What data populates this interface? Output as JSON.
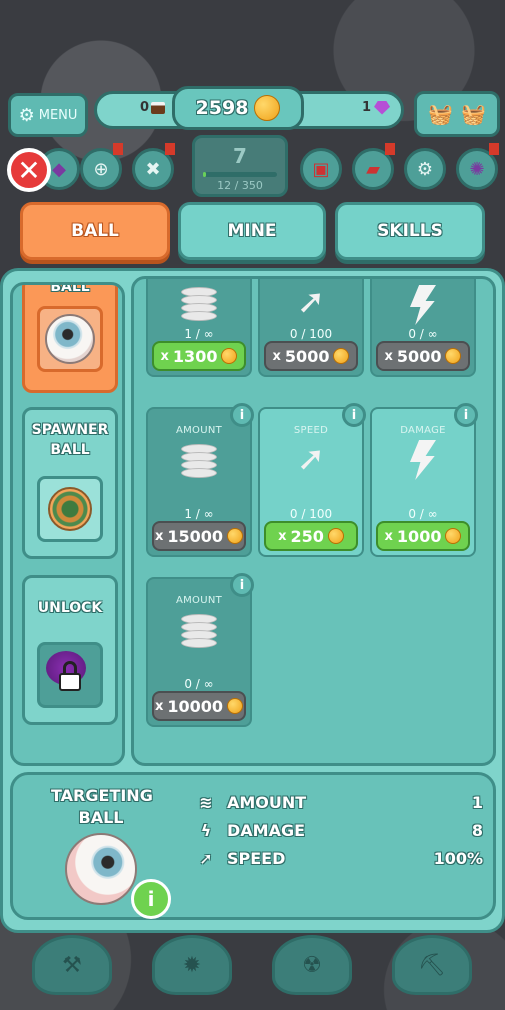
{
  "top_bar": {
    "menu_label": "MENU",
    "left_resource": "0",
    "gold_amount": "2598",
    "gem_amount": "1"
  },
  "level": {
    "number": "7",
    "progress_text": "12 / 350",
    "progress_fraction": 0.034
  },
  "tabs": [
    {
      "label": "BALL",
      "active": true
    },
    {
      "label": "MINE",
      "active": false
    },
    {
      "label": "SKILLS",
      "active": false
    }
  ],
  "sidebar": {
    "items": [
      {
        "label": "BALL",
        "active": true
      },
      {
        "label": "SPAWNER\nBALL",
        "active": false
      },
      {
        "label": "UNLOCK",
        "active": false,
        "locked": true
      }
    ]
  },
  "upgrade_rows": [
    [
      {
        "caption": "",
        "icon": "coins-stack-icon",
        "progress": "1 / ∞",
        "price": "1300",
        "affordable": true
      },
      {
        "caption": "",
        "icon": "speed-arrow-icon",
        "progress": "0 / 100",
        "price": "5000",
        "affordable": false
      },
      {
        "caption": "",
        "icon": "lightning-icon",
        "progress": "0 / ∞",
        "price": "5000",
        "affordable": false
      }
    ],
    [
      {
        "caption": "AMOUNT",
        "icon": "coins-stack-icon",
        "progress": "1 / ∞",
        "price": "15000",
        "affordable": false
      },
      {
        "caption": "SPEED",
        "icon": "speed-arrow-icon",
        "progress": "0 / 100",
        "price": "250",
        "affordable": true
      },
      {
        "caption": "DAMAGE",
        "icon": "lightning-icon",
        "progress": "0 / ∞",
        "price": "1000",
        "affordable": true
      }
    ],
    [
      {
        "caption": "AMOUNT",
        "icon": "coins-stack-icon",
        "progress": "0 / ∞",
        "price": "10000",
        "affordable": false
      }
    ]
  ],
  "price_prefix": "x",
  "info_glyph": "i",
  "selected_ball": {
    "name": "TARGETING\nBALL",
    "stats": [
      {
        "icon": "coins-stack-icon",
        "label": "AMOUNT",
        "value": "1"
      },
      {
        "icon": "lightning-icon",
        "label": "DAMAGE",
        "value": "8"
      },
      {
        "icon": "speed-arrow-icon",
        "label": "SPEED",
        "value": "100%"
      }
    ]
  },
  "colors": {
    "panel": "#7fd4cb",
    "panel_dark": "#3f8e88",
    "active_orange": "#fb9857",
    "buy_green": "#6fd24f",
    "disabled_gray": "#6d7173"
  }
}
